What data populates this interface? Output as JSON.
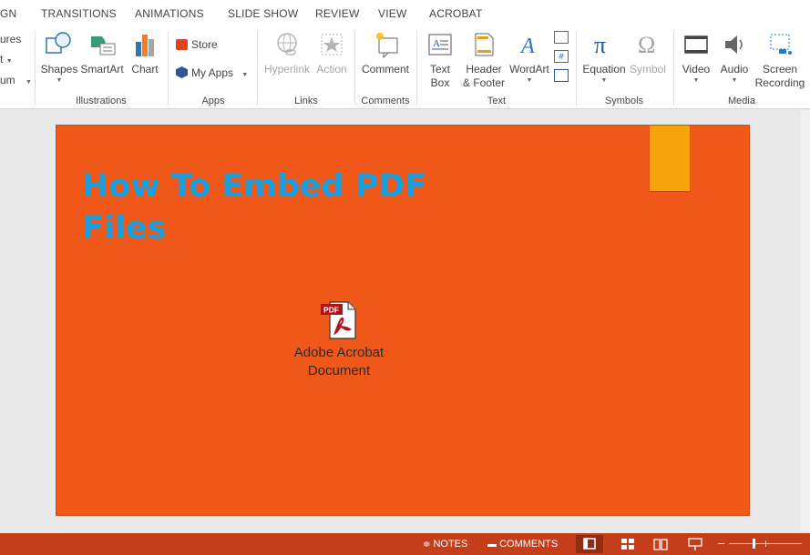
{
  "tabs": [
    "GN",
    "TRANSITIONS",
    "ANIMATIONS",
    "SLIDE SHOW",
    "REVIEW",
    "VIEW",
    "ACROBAT"
  ],
  "ribbon": {
    "partial": {
      "pictures": "ures",
      "screenshot": "t",
      "album": "um"
    },
    "illustrations": {
      "shapes": "Shapes",
      "smartart": "SmartArt",
      "chart": "Chart",
      "group": "Illustrations"
    },
    "apps": {
      "store": "Store",
      "myapps": "My Apps",
      "group": "Apps"
    },
    "links": {
      "hyperlink": "Hyperlink",
      "action": "Action",
      "group": "Links"
    },
    "comments": {
      "comment": "Comment",
      "group": "Comments"
    },
    "text": {
      "textbox_1": "Text",
      "textbox_2": "Box",
      "header_1": "Header",
      "header_2": "& Footer",
      "wordart": "WordArt",
      "group": "Text"
    },
    "symbols": {
      "equation": "Equation",
      "symbol": "Symbol",
      "group": "Symbols"
    },
    "media": {
      "video": "Video",
      "audio": "Audio",
      "screen_1": "Screen",
      "screen_2": "Recording",
      "group": "Media"
    }
  },
  "slide": {
    "title_line1": "How To Embed PDF",
    "title_line2": "Files",
    "object_label_1": "Adobe Acrobat",
    "object_label_2": "Document",
    "pdf_icon_text": "PDF"
  },
  "status": {
    "notes": "NOTES",
    "comments": "COMMENTS"
  },
  "colors": {
    "slide_bg": "#ef5818",
    "title": "#1a9fe0",
    "bookmark": "#f7a30b",
    "status_bar": "#c43e1c"
  }
}
